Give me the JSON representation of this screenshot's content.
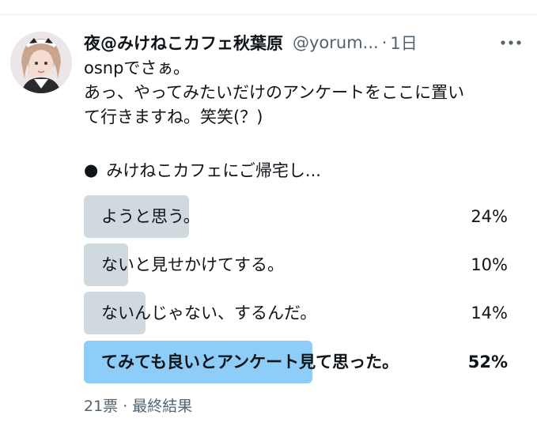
{
  "tweet": {
    "display_name": "夜@みけねこカフェ秋葉原",
    "handle": "@yorum...",
    "separator": "·",
    "time": "1日",
    "text_lines": [
      "osnpでさぁ。",
      "あっ、やってみたいだけのアンケートをここに置い",
      "て行きますね。笑笑(？)"
    ]
  },
  "poll": {
    "question_bullet": "●",
    "question": "みけねこカフェにご帰宅し...",
    "options": [
      {
        "label": "ようと思う。",
        "percent_text": "24%",
        "percent": 24,
        "winner": false
      },
      {
        "label": "ないと見せかけてする。",
        "percent_text": "10%",
        "percent": 10,
        "winner": false
      },
      {
        "label": "ないんじゃない、するんだ。",
        "percent_text": "14%",
        "percent": 14,
        "winner": false
      },
      {
        "label": "てみても良いとアンケート見て思った。",
        "percent_text": "52%",
        "percent": 52,
        "winner": true
      }
    ],
    "footer": "21票 · 最終結果"
  },
  "colors": {
    "text": "#0f1419",
    "secondary": "#536471",
    "bar": "#cfd9de",
    "winner_bar": "#8ecdf8"
  },
  "icons": {
    "more": "more-horizontal-icon",
    "avatar": "user-avatar"
  }
}
